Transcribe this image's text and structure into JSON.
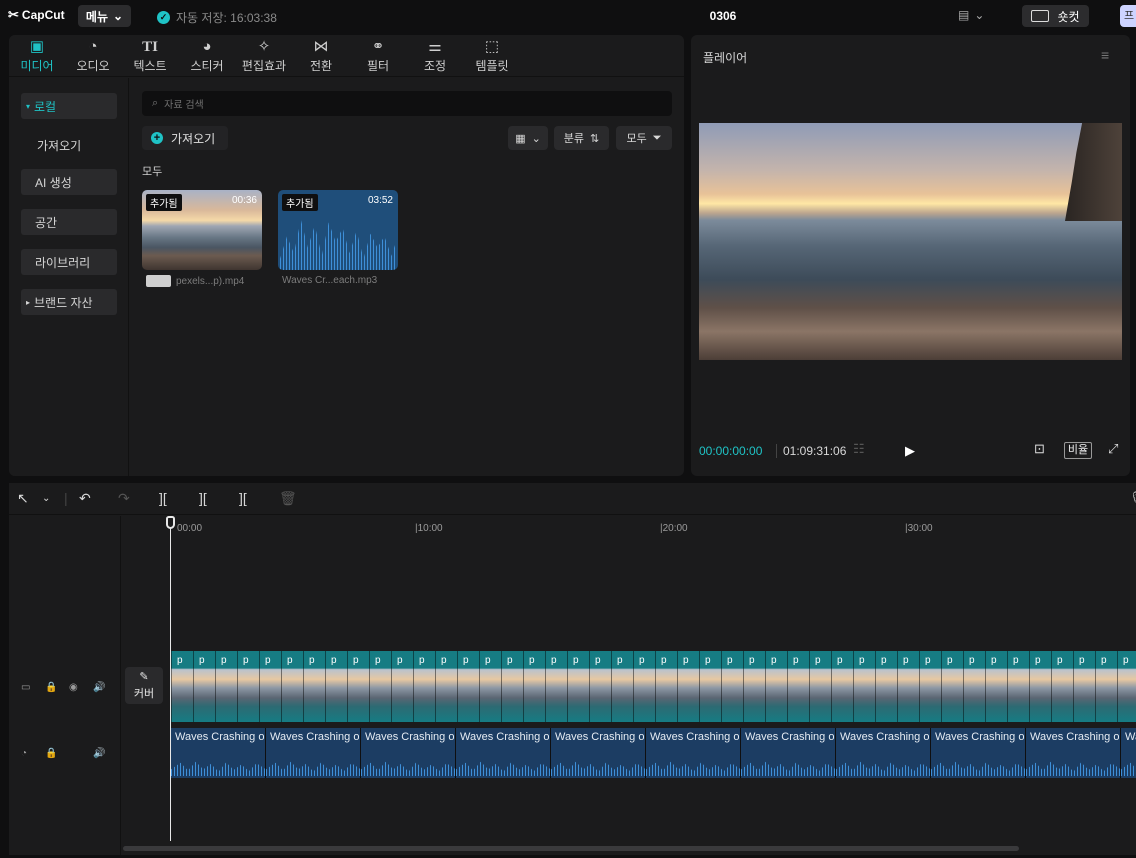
{
  "app": {
    "logo": "CapCut",
    "menu_label": "메뉴",
    "autosave": "자동 저장: 16:03:38",
    "project_title": "0306",
    "shortcut_label": "숏컷",
    "edge_label": "프"
  },
  "media_panel": {
    "tabs": [
      {
        "label": "미디어",
        "icon": "media-icon",
        "active": true
      },
      {
        "label": "오디오",
        "icon": "audio-icon"
      },
      {
        "label": "텍스트",
        "icon": "text-icon"
      },
      {
        "label": "스티커",
        "icon": "sticker-icon"
      },
      {
        "label": "편집효과",
        "icon": "effects-icon"
      },
      {
        "label": "전환",
        "icon": "transition-icon"
      },
      {
        "label": "필터",
        "icon": "filter-icon"
      },
      {
        "label": "조정",
        "icon": "adjust-icon"
      },
      {
        "label": "템플릿",
        "icon": "template-icon"
      }
    ],
    "sidebar": [
      {
        "label": "로컬",
        "active": true
      },
      {
        "label": "가져오기"
      },
      {
        "label": "AI 생성"
      },
      {
        "label": "공간"
      },
      {
        "label": "라이브러리"
      },
      {
        "label": "브랜드 자산"
      }
    ],
    "search_placeholder": "자료 검색",
    "import_label": "가져오기",
    "sort_label": "분류",
    "filter_label": "모두",
    "section_label": "모두",
    "items": [
      {
        "badge": "추가됨",
        "duration": "00:36",
        "name": "pexels...p).mp4",
        "type": "video"
      },
      {
        "badge": "추가됨",
        "duration": "03:52",
        "name": "Waves Cr...each.mp3",
        "type": "audio"
      }
    ]
  },
  "player": {
    "title": "플레이어",
    "current_time": "00:00:00:00",
    "total_time": "01:09:31:06",
    "ratio_label": "비율"
  },
  "timeline": {
    "ruler": [
      "00:00",
      "|10:00",
      "|20:00",
      "|30:00"
    ],
    "cover_label": "커버",
    "video_frame_label": "p",
    "audio_clip_label": "Waves Crashing o",
    "audio_clip_count": 11
  },
  "colors": {
    "accent": "#1fc3c6",
    "video_track": "#167c83",
    "audio_track": "#1c3d63"
  }
}
